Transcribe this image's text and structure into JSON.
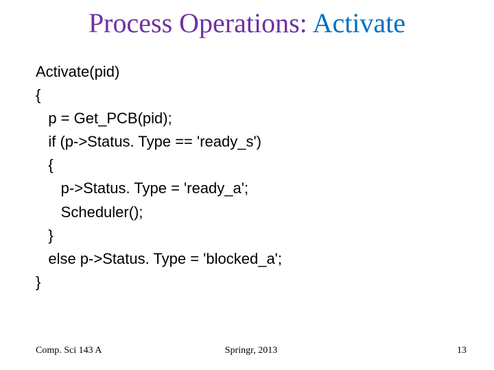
{
  "title": {
    "part1": "Process Operations: ",
    "part2": "Activate"
  },
  "code": {
    "l1": "Activate(pid)",
    "l2": "{",
    "l3": "   p = Get_PCB(pid);",
    "l4": "   if (p->Status. Type == 'ready_s')",
    "l5": "   {",
    "l6": "      p->Status. Type = 'ready_a';",
    "l7": "      Scheduler();",
    "l8": "   }",
    "l9": "   else p->Status. Type = 'blocked_a';",
    "l10": "}"
  },
  "footer": {
    "left": "Comp. Sci 143 A",
    "center": "Springr, 2013",
    "right": "13"
  }
}
